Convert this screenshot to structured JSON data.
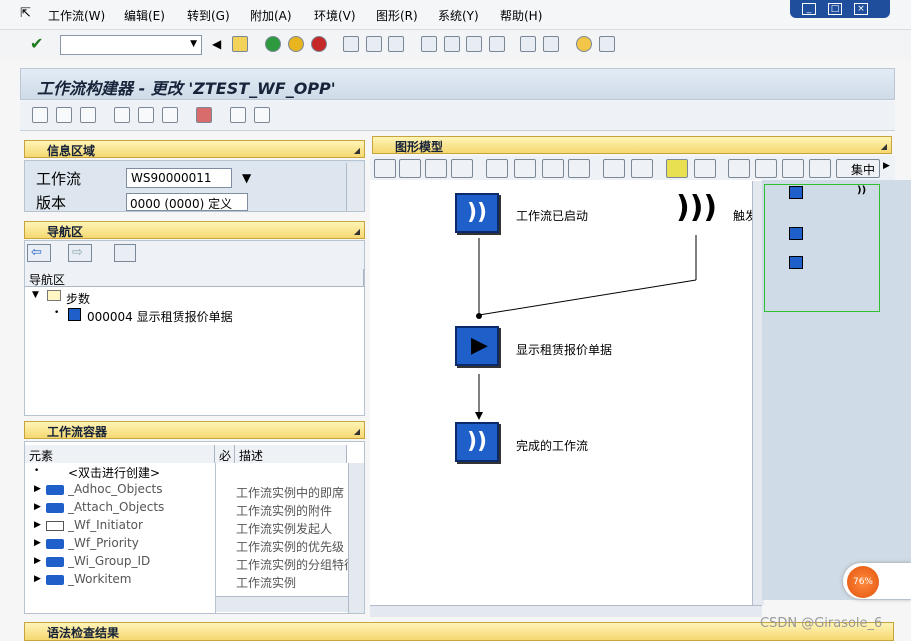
{
  "menu": {
    "items": [
      "工作流(W)",
      "编辑(E)",
      "转到(G)",
      "附加(A)",
      "环境(V)",
      "图形(R)",
      "系统(Y)",
      "帮助(H)"
    ]
  },
  "window": {
    "title": "工作流构建器 - 更改 'ZTEST_WF_OPP'"
  },
  "info": {
    "header": "信息区域",
    "workflow_label": "工作流",
    "workflow_value": "WS90000011",
    "version_label": "版本",
    "version_value": "0000 (0000) 定义"
  },
  "nav": {
    "header": "导航区",
    "table_header": "导航区",
    "folder": "步数",
    "step": "000004 显示租赁报价单据"
  },
  "container": {
    "header": "工作流容器",
    "col_element": "元素",
    "col_flag": "必",
    "col_desc": "描述",
    "rows": [
      {
        "name": "<双击进行创建>",
        "desc": ""
      },
      {
        "name": "_Adhoc_Objects",
        "desc": "工作流实例中的即席"
      },
      {
        "name": "_Attach_Objects",
        "desc": "工作流实例的附件"
      },
      {
        "name": "_Wf_Initiator",
        "desc": "工作流实例发起人"
      },
      {
        "name": "_Wf_Priority",
        "desc": "工作流实例的优先级"
      },
      {
        "name": "_Wi_Group_ID",
        "desc": "工作流实例的分组特征"
      },
      {
        "name": "_Workitem",
        "desc": "工作流实例"
      }
    ]
  },
  "graphic": {
    "header": "图形模型",
    "zoom_label": "集中",
    "node_start": "工作流已启动",
    "node_trigger": "触发",
    "node_step": "显示租赁报价单据",
    "node_end": "完成的工作流"
  },
  "footer": {
    "syntax": "语法检查结果"
  },
  "overlay": {
    "watermark": "CSDN @Girasole_6",
    "gauge": "76%"
  },
  "colors": {
    "accent": "#1e5fc9",
    "panel_header": "#f5d870"
  }
}
